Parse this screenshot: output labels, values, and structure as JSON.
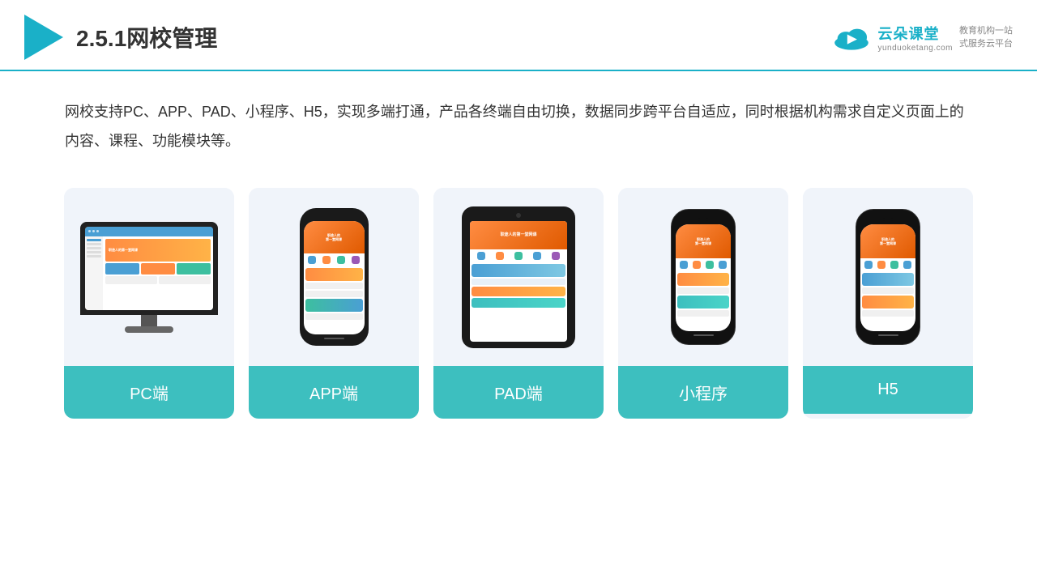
{
  "header": {
    "section_number": "2.5.1",
    "title": "网校管理",
    "brand_name": "云朵课堂",
    "brand_url": "yunduoketang.com",
    "brand_tagline": "教育机构一站\n式服务云平台"
  },
  "description": {
    "text": "网校支持PC、APP、PAD、小程序、H5，实现多端打通，产品各终端自由切换，数据同步跨平台自适应，同时根据机构需求自定义页面上的内容、课程、功能模块等。"
  },
  "cards": [
    {
      "id": "pc",
      "label": "PC端"
    },
    {
      "id": "app",
      "label": "APP端"
    },
    {
      "id": "pad",
      "label": "PAD端"
    },
    {
      "id": "miniprogram",
      "label": "小程序"
    },
    {
      "id": "h5",
      "label": "H5"
    }
  ],
  "colors": {
    "accent": "#3dbfbf",
    "header_line": "#1ab0c8",
    "triangle": "#1ab0c8"
  }
}
